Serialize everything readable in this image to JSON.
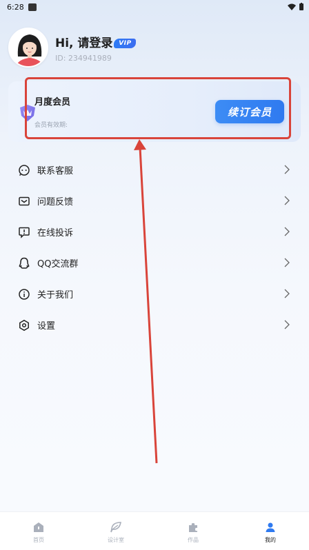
{
  "status_bar": {
    "time": "6:28"
  },
  "profile": {
    "greeting": "Hi, 请登录",
    "vip_badge": "VIP",
    "user_id": "ID: 234941989"
  },
  "member_card": {
    "title": "月度会员",
    "expire_label": "会员有效期:",
    "renew_button": "续订会员"
  },
  "menu": {
    "items": [
      {
        "label": "联系客服",
        "icon": "customer-service-icon"
      },
      {
        "label": "问题反馈",
        "icon": "mail-icon"
      },
      {
        "label": "在线投诉",
        "icon": "complaint-icon"
      },
      {
        "label": "QQ交流群",
        "icon": "qq-icon"
      },
      {
        "label": "关于我们",
        "icon": "info-icon"
      },
      {
        "label": "设置",
        "icon": "settings-icon"
      }
    ]
  },
  "tab_bar": {
    "tabs": [
      {
        "label": "首页",
        "icon": "home-icon",
        "active": false
      },
      {
        "label": "设计室",
        "icon": "leaf-icon",
        "active": false
      },
      {
        "label": "作品",
        "icon": "puzzle-icon",
        "active": false
      },
      {
        "label": "我的",
        "icon": "person-icon",
        "active": true
      }
    ]
  },
  "colors": {
    "accent_blue": "#2f7af0",
    "annotation_red": "#d9443a"
  }
}
